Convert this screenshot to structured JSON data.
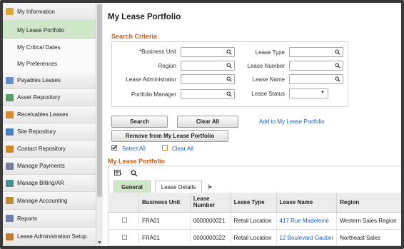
{
  "sidebar": {
    "header": "My Information",
    "subitems": [
      "My Lease Portfolio",
      "My Critical Dates",
      "My Preferences"
    ],
    "items": [
      {
        "label": "Payables Leases",
        "icon": "payables-icon",
        "color": "#6a8cc7"
      },
      {
        "label": "Asset Repository",
        "icon": "asset-icon",
        "color": "#5a9a6a"
      },
      {
        "label": "Receivables Leases",
        "icon": "receivables-icon",
        "color": "#d08a3a"
      },
      {
        "label": "Site Repository",
        "icon": "site-icon",
        "color": "#4a7fc0"
      },
      {
        "label": "Contact Repository",
        "icon": "contact-icon",
        "color": "#c98b2f"
      },
      {
        "label": "Manage Payments",
        "icon": "payments-icon",
        "color": "#7b7b9a"
      },
      {
        "label": "Manage Billing/AR",
        "icon": "billing-icon",
        "color": "#4c8f8c"
      },
      {
        "label": "Manage Accounting",
        "icon": "accounting-icon",
        "color": "#b58c3d"
      },
      {
        "label": "Reports",
        "icon": "reports-icon",
        "color": "#6d7fa8"
      },
      {
        "label": "Lease Administration Setup",
        "icon": "setup-icon",
        "color": "#c07a3a"
      }
    ]
  },
  "main": {
    "title": "My Lease Portfolio",
    "search": {
      "title": "Search Criteria",
      "labels": {
        "business_unit": "*Business Unit",
        "region": "Region",
        "lease_administrator": "Lease Administrator",
        "portfolio_manager": "Portfolio Manager",
        "lease_type": "Lease Type",
        "lease_number": "Lease Number",
        "lease_name": "Lease Name",
        "lease_status": "Lease Status"
      }
    },
    "buttons": {
      "search": "Search",
      "clear_all": "Clear All",
      "remove": "Remove from My Lease Portfolio"
    },
    "links": {
      "add": "Add to My Lease Portfolio",
      "select_all": "Select All",
      "clear_all": "Clear All"
    },
    "grid": {
      "title": "My Lease Portfolio",
      "tabs": [
        "General",
        "Lease Details"
      ],
      "columns": [
        "Business Unit",
        "Lease Number",
        "Lease Type",
        "Lease Name",
        "Region"
      ],
      "rows": [
        {
          "bu": "FRA01",
          "number": "0000000021",
          "type": "Retail Location",
          "name": "417 Rue Madeleine",
          "region": "Western Sales Region"
        },
        {
          "bu": "FRA01",
          "number": "0000000022",
          "type": "Retail Location",
          "name": "12 Boulevard Gautier",
          "region": "Northeast Sales"
        }
      ]
    }
  },
  "colors": {
    "accent_orange": "#c65d1a",
    "active_green": "#cfe6c9",
    "link_blue": "#1a5fb4"
  }
}
